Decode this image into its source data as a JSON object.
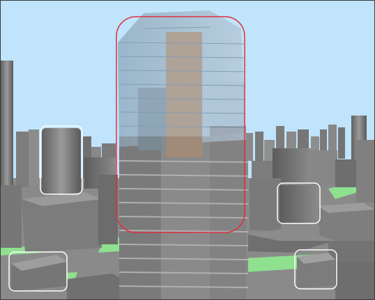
{
  "scene": {
    "sky_color": "#bfe4fb",
    "ground_color": "#8fe08f",
    "building_color": "#7a7a7a",
    "glass_color": "#9fb6c8",
    "highlight_box_color": "#e03040",
    "selection_box_color": "#ffffff"
  },
  "selections": [
    {
      "name": "selection-box-tower",
      "kind": "highlight"
    },
    {
      "name": "selection-box-left-cylinder",
      "kind": "selection"
    },
    {
      "name": "selection-box-right-block",
      "kind": "selection"
    },
    {
      "name": "selection-box-bottom-left",
      "kind": "selection"
    },
    {
      "name": "selection-box-bottom-right",
      "kind": "selection"
    }
  ]
}
